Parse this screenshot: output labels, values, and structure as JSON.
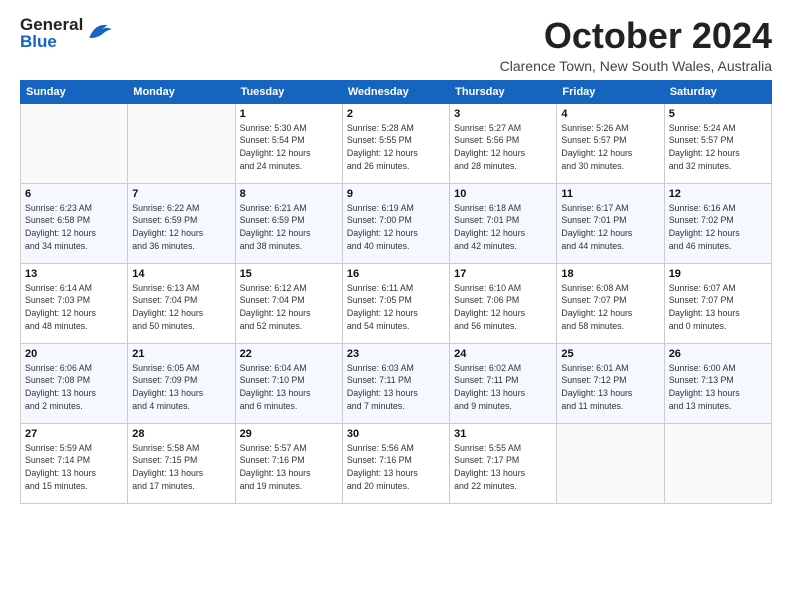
{
  "logo": {
    "general": "General",
    "blue": "Blue"
  },
  "header": {
    "title": "October 2024",
    "subtitle": "Clarence Town, New South Wales, Australia"
  },
  "days_of_week": [
    "Sunday",
    "Monday",
    "Tuesday",
    "Wednesday",
    "Thursday",
    "Friday",
    "Saturday"
  ],
  "weeks": [
    [
      {
        "day": "",
        "info": ""
      },
      {
        "day": "",
        "info": ""
      },
      {
        "day": "1",
        "info": "Sunrise: 5:30 AM\nSunset: 5:54 PM\nDaylight: 12 hours\nand 24 minutes."
      },
      {
        "day": "2",
        "info": "Sunrise: 5:28 AM\nSunset: 5:55 PM\nDaylight: 12 hours\nand 26 minutes."
      },
      {
        "day": "3",
        "info": "Sunrise: 5:27 AM\nSunset: 5:56 PM\nDaylight: 12 hours\nand 28 minutes."
      },
      {
        "day": "4",
        "info": "Sunrise: 5:26 AM\nSunset: 5:57 PM\nDaylight: 12 hours\nand 30 minutes."
      },
      {
        "day": "5",
        "info": "Sunrise: 5:24 AM\nSunset: 5:57 PM\nDaylight: 12 hours\nand 32 minutes."
      }
    ],
    [
      {
        "day": "6",
        "info": "Sunrise: 6:23 AM\nSunset: 6:58 PM\nDaylight: 12 hours\nand 34 minutes."
      },
      {
        "day": "7",
        "info": "Sunrise: 6:22 AM\nSunset: 6:59 PM\nDaylight: 12 hours\nand 36 minutes."
      },
      {
        "day": "8",
        "info": "Sunrise: 6:21 AM\nSunset: 6:59 PM\nDaylight: 12 hours\nand 38 minutes."
      },
      {
        "day": "9",
        "info": "Sunrise: 6:19 AM\nSunset: 7:00 PM\nDaylight: 12 hours\nand 40 minutes."
      },
      {
        "day": "10",
        "info": "Sunrise: 6:18 AM\nSunset: 7:01 PM\nDaylight: 12 hours\nand 42 minutes."
      },
      {
        "day": "11",
        "info": "Sunrise: 6:17 AM\nSunset: 7:01 PM\nDaylight: 12 hours\nand 44 minutes."
      },
      {
        "day": "12",
        "info": "Sunrise: 6:16 AM\nSunset: 7:02 PM\nDaylight: 12 hours\nand 46 minutes."
      }
    ],
    [
      {
        "day": "13",
        "info": "Sunrise: 6:14 AM\nSunset: 7:03 PM\nDaylight: 12 hours\nand 48 minutes."
      },
      {
        "day": "14",
        "info": "Sunrise: 6:13 AM\nSunset: 7:04 PM\nDaylight: 12 hours\nand 50 minutes."
      },
      {
        "day": "15",
        "info": "Sunrise: 6:12 AM\nSunset: 7:04 PM\nDaylight: 12 hours\nand 52 minutes."
      },
      {
        "day": "16",
        "info": "Sunrise: 6:11 AM\nSunset: 7:05 PM\nDaylight: 12 hours\nand 54 minutes."
      },
      {
        "day": "17",
        "info": "Sunrise: 6:10 AM\nSunset: 7:06 PM\nDaylight: 12 hours\nand 56 minutes."
      },
      {
        "day": "18",
        "info": "Sunrise: 6:08 AM\nSunset: 7:07 PM\nDaylight: 12 hours\nand 58 minutes."
      },
      {
        "day": "19",
        "info": "Sunrise: 6:07 AM\nSunset: 7:07 PM\nDaylight: 13 hours\nand 0 minutes."
      }
    ],
    [
      {
        "day": "20",
        "info": "Sunrise: 6:06 AM\nSunset: 7:08 PM\nDaylight: 13 hours\nand 2 minutes."
      },
      {
        "day": "21",
        "info": "Sunrise: 6:05 AM\nSunset: 7:09 PM\nDaylight: 13 hours\nand 4 minutes."
      },
      {
        "day": "22",
        "info": "Sunrise: 6:04 AM\nSunset: 7:10 PM\nDaylight: 13 hours\nand 6 minutes."
      },
      {
        "day": "23",
        "info": "Sunrise: 6:03 AM\nSunset: 7:11 PM\nDaylight: 13 hours\nand 7 minutes."
      },
      {
        "day": "24",
        "info": "Sunrise: 6:02 AM\nSunset: 7:11 PM\nDaylight: 13 hours\nand 9 minutes."
      },
      {
        "day": "25",
        "info": "Sunrise: 6:01 AM\nSunset: 7:12 PM\nDaylight: 13 hours\nand 11 minutes."
      },
      {
        "day": "26",
        "info": "Sunrise: 6:00 AM\nSunset: 7:13 PM\nDaylight: 13 hours\nand 13 minutes."
      }
    ],
    [
      {
        "day": "27",
        "info": "Sunrise: 5:59 AM\nSunset: 7:14 PM\nDaylight: 13 hours\nand 15 minutes."
      },
      {
        "day": "28",
        "info": "Sunrise: 5:58 AM\nSunset: 7:15 PM\nDaylight: 13 hours\nand 17 minutes."
      },
      {
        "day": "29",
        "info": "Sunrise: 5:57 AM\nSunset: 7:16 PM\nDaylight: 13 hours\nand 19 minutes."
      },
      {
        "day": "30",
        "info": "Sunrise: 5:56 AM\nSunset: 7:16 PM\nDaylight: 13 hours\nand 20 minutes."
      },
      {
        "day": "31",
        "info": "Sunrise: 5:55 AM\nSunset: 7:17 PM\nDaylight: 13 hours\nand 22 minutes."
      },
      {
        "day": "",
        "info": ""
      },
      {
        "day": "",
        "info": ""
      }
    ]
  ]
}
